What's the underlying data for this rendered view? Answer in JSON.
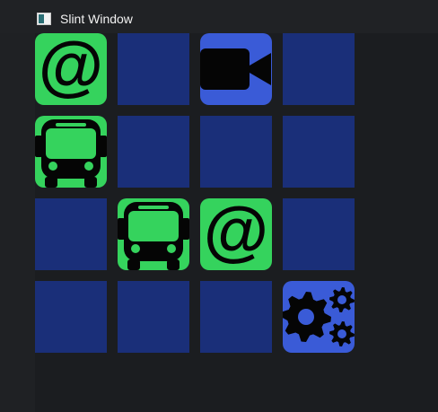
{
  "window": {
    "title": "Slint Window",
    "icon": "window-icon"
  },
  "board": {
    "rows": 4,
    "columns": 4,
    "tiles": [
      {
        "state": "revealed",
        "icon": "at-sign-icon",
        "color": "#35d35d"
      },
      {
        "state": "hidden",
        "icon": null,
        "color": "#1a2f79"
      },
      {
        "state": "revealed",
        "icon": "video-camera-icon",
        "color": "#3a5bd7"
      },
      {
        "state": "hidden",
        "icon": null,
        "color": "#1a2f79"
      },
      {
        "state": "revealed",
        "icon": "bus-icon",
        "color": "#35d35d"
      },
      {
        "state": "hidden",
        "icon": null,
        "color": "#1a2f79"
      },
      {
        "state": "hidden",
        "icon": null,
        "color": "#1a2f79"
      },
      {
        "state": "hidden",
        "icon": null,
        "color": "#1a2f79"
      },
      {
        "state": "hidden",
        "icon": null,
        "color": "#1a2f79"
      },
      {
        "state": "revealed",
        "icon": "bus-icon",
        "color": "#35d35d"
      },
      {
        "state": "revealed",
        "icon": "at-sign-icon",
        "color": "#35d35d"
      },
      {
        "state": "hidden",
        "icon": null,
        "color": "#1a2f79"
      },
      {
        "state": "hidden",
        "icon": null,
        "color": "#1a2f79"
      },
      {
        "state": "hidden",
        "icon": null,
        "color": "#1a2f79"
      },
      {
        "state": "hidden",
        "icon": null,
        "color": "#1a2f79"
      },
      {
        "state": "revealed",
        "icon": "gears-icon",
        "color": "#3a5bd7"
      }
    ]
  }
}
